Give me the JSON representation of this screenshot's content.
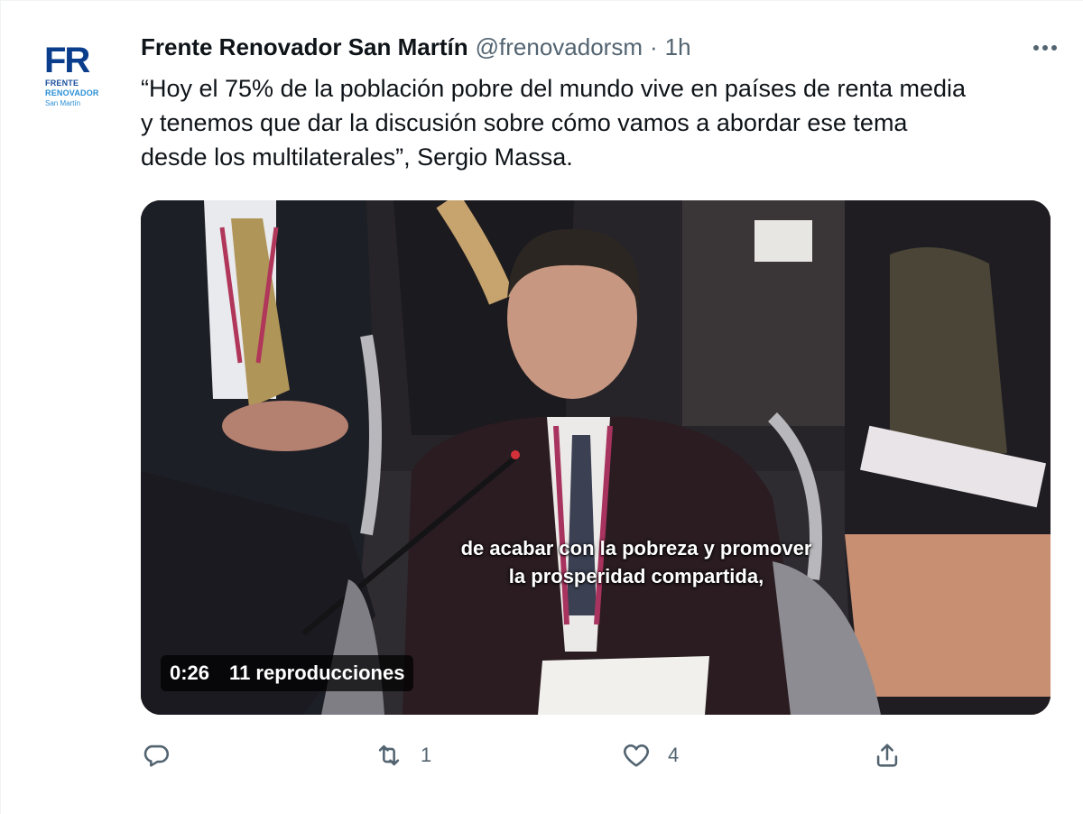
{
  "tweet": {
    "avatar": {
      "logo_letters": "FR",
      "line1": "FRENTE",
      "line2": "RENOVADOR",
      "line3": "San Martín"
    },
    "author_name": "Frente Renovador San Martín",
    "handle": "@frenovadorsm",
    "separator": "·",
    "time": "1h",
    "more_icon": "more-horizontal-icon",
    "text": "“Hoy el 75% de la población pobre del mundo vive en países de renta media\ny tenemos que dar la discusión sobre cómo vamos a abordar ese tema\ndesde los multilaterales”, Sergio Massa.",
    "video": {
      "subtitle_line1": "de acabar con la pobreza y promover",
      "subtitle_line2": "la prosperidad compartida,",
      "duration": "0:26",
      "views": "11 reproducciones"
    },
    "actions": {
      "reply": {
        "icon": "reply-icon",
        "count": ""
      },
      "retweet": {
        "icon": "retweet-icon",
        "count": "1"
      },
      "like": {
        "icon": "heart-icon",
        "count": "4"
      },
      "share": {
        "icon": "share-icon",
        "count": ""
      }
    },
    "colors": {
      "text": "#0f1419",
      "muted": "#536471",
      "brand_blue": "#0a3d8c"
    }
  }
}
